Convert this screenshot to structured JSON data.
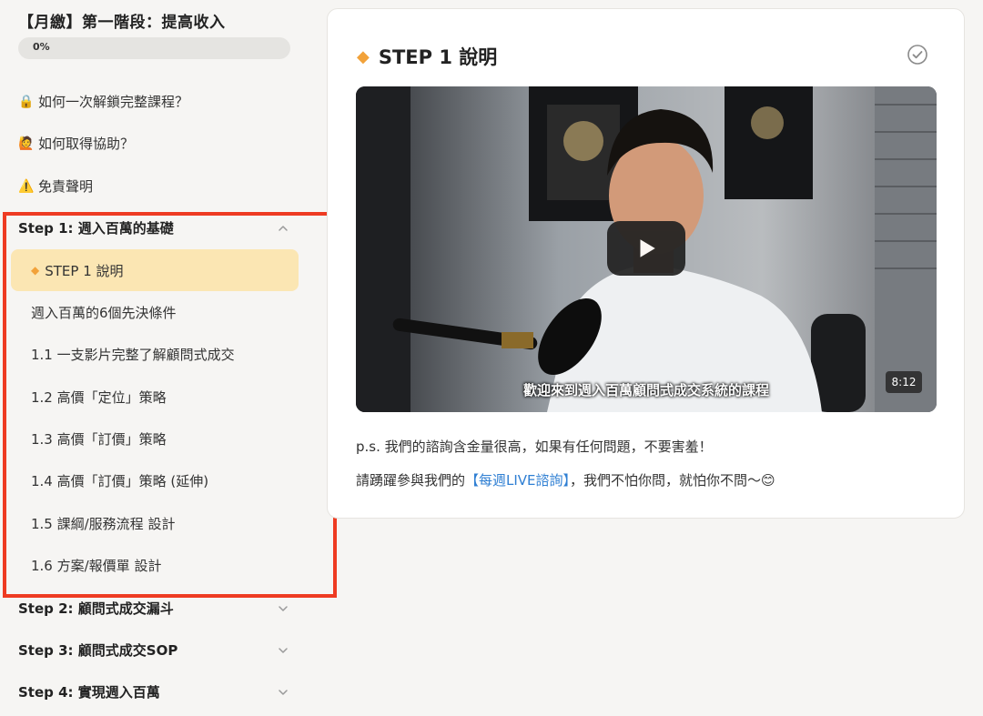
{
  "sidebar": {
    "course_title": "【月繳】第一階段：提高收入",
    "progress": {
      "percent": 0,
      "label": "0%"
    },
    "info_links": [
      {
        "icon": "lock-icon",
        "glyph": "🔒",
        "label": "如何一次解鎖完整課程？"
      },
      {
        "icon": "raising-hand-icon",
        "glyph": "🙋",
        "label": "如何取得協助？"
      },
      {
        "icon": "warning-icon",
        "glyph": "⚠️",
        "label": "免責聲明"
      }
    ],
    "sections": [
      {
        "title": "Step 1: 週入百萬的基礎",
        "expanded": true,
        "lessons": [
          {
            "label": "STEP 1 說明",
            "active": true,
            "icon": "diamond-icon"
          },
          {
            "label": "週入百萬的6個先決條件"
          },
          {
            "label": "1.1 一支影片完整了解顧問式成交"
          },
          {
            "label": "1.2 高價「定位」策略"
          },
          {
            "label": "1.3 高價「訂價」策略"
          },
          {
            "label": "1.4 高價「訂價」策略 (延伸)"
          },
          {
            "label": "1.5 課綱/服務流程 設計"
          },
          {
            "label": "1.6 方案/報價單 設計"
          }
        ]
      },
      {
        "title": "Step 2: 顧問式成交漏斗",
        "expanded": false
      },
      {
        "title": "Step 3: 顧問式成交SOP",
        "expanded": false
      },
      {
        "title": "Step 4: 實現週入百萬",
        "expanded": false
      }
    ],
    "highlight_color": "#ee3b22"
  },
  "main": {
    "title_icon": "diamond-icon",
    "title": "STEP 1 說明",
    "video": {
      "caption": "歡迎來到週入百萬顧問式成交系統的課程",
      "duration": "8:12"
    },
    "paragraph1": "p.s. 我們的諮詢含金量很高，如果有任何問題，不要害羞！",
    "paragraph2": {
      "before": "請踴躍參與我們的",
      "link": "【每週LIVE諮詢】",
      "after": "，我們不怕你問，就怕你不問～😊"
    }
  },
  "colors": {
    "accent": "#f2a23a",
    "active_lesson_bg": "#fbe6b3",
    "link": "#2f7fd3"
  }
}
